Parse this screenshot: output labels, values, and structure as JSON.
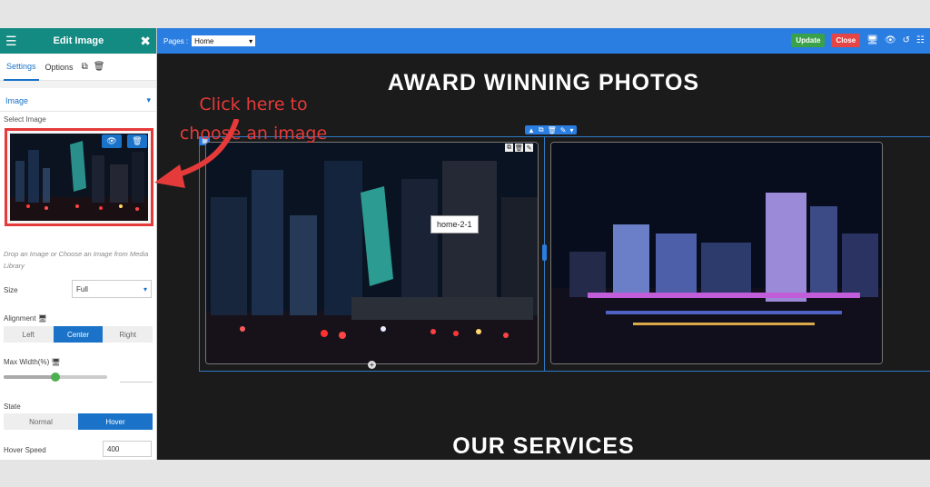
{
  "panel": {
    "title": "Edit Image",
    "tabs": [
      "Settings",
      "Options"
    ],
    "section": "Image",
    "select_image_label": "Select Image",
    "hint": "Drop an Image or Choose an Image from Media Library",
    "size_label": "Size",
    "size_value": "Full",
    "alignment_label": "Alignment",
    "alignment_options": [
      "Left",
      "Center",
      "Right"
    ],
    "alignment_selected": "Center",
    "max_width_label": "Max Width(%)",
    "max_width_level": 0.5,
    "state_label": "State",
    "state_options": [
      "Normal",
      "Hover"
    ],
    "state_selected": "Hover",
    "hover_speed_label": "Hover Speed",
    "hover_speed_value": "400"
  },
  "toolbar": {
    "pages_label": "Pages :",
    "pages_value": "Home",
    "update_label": "Update",
    "close_label": "Close"
  },
  "canvas": {
    "heading_top": "AWARD WINNING PHOTOS",
    "heading_bottom": "OUR SERVICES",
    "tooltip": "home-2-1"
  },
  "annotation": {
    "line1": "Click here to",
    "line2": "choose an image"
  },
  "colors": {
    "panel_header": "#138a82",
    "accent_blue": "#2a7de1",
    "update_green": "#3aa14b",
    "close_red": "#e64545",
    "annotation_red": "#e53a3a"
  }
}
